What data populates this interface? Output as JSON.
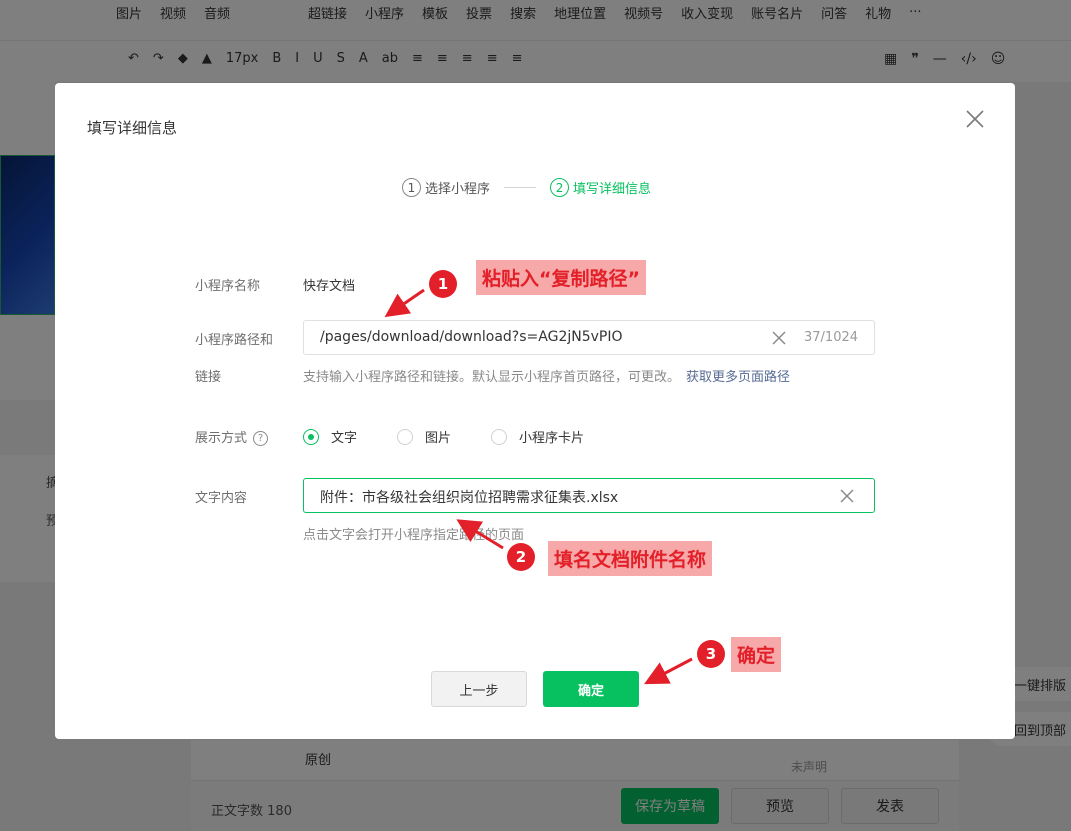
{
  "editor": {
    "toolbar_row1_left": [
      "图片",
      "视频",
      "音频"
    ],
    "toolbar_row1_right": [
      "超链接",
      "小程序",
      "模板",
      "投票",
      "搜索",
      "地理位置",
      "视频号",
      "收入变现",
      "账号名片",
      "问答",
      "礼物",
      "···"
    ],
    "font_size": "17px",
    "format_items": [
      "B",
      "I",
      "U",
      "S",
      "A",
      "ab"
    ],
    "left_chars": [
      "摘",
      "预"
    ],
    "original_label": "原创",
    "statement_label": "未声明",
    "word_count_label": "正文字数",
    "word_count_value": "180",
    "save_draft": "保存为草稿",
    "preview": "预览",
    "publish": "发表",
    "one_click_layout": "一键排版",
    "back_to_top": "回到顶部"
  },
  "dialog": {
    "title": "填写详细信息",
    "steps": [
      {
        "num": "1",
        "label": "选择小程序"
      },
      {
        "num": "2",
        "label": "填写详细信息"
      }
    ],
    "name_label": "小程序名称",
    "name_value": "快存文档",
    "path_label_line1": "小程序路径和",
    "path_label_line2": "链接",
    "path_value": "/pages/download/download?s=AG2jN5vPIO",
    "path_counter": "37/1024",
    "path_hint": "支持输入小程序路径和链接。默认显示小程序首页路径，可更改。",
    "path_hint_link": "获取更多页面路径",
    "display_label": "展示方式",
    "display_options": [
      "文字",
      "图片",
      "小程序卡片"
    ],
    "display_selected": "文字",
    "text_label": "文字内容",
    "text_value": "附件：市各级社会组织岗位招聘需求征集表.xlsx",
    "text_hint": "点击文字会打开小程序指定路径的页面",
    "prev_button": "上一步",
    "ok_button": "确定"
  },
  "annotations": [
    {
      "num": "1",
      "text": "粘贴入“复制路径”"
    },
    {
      "num": "2",
      "text": "填名文档附件名称"
    },
    {
      "num": "3",
      "text": "确定"
    }
  ],
  "colors": {
    "accent_green": "#07c160",
    "annotation_red": "#e3202a",
    "annotation_bg": "#f7a8a8",
    "link_blue": "#576b95"
  }
}
